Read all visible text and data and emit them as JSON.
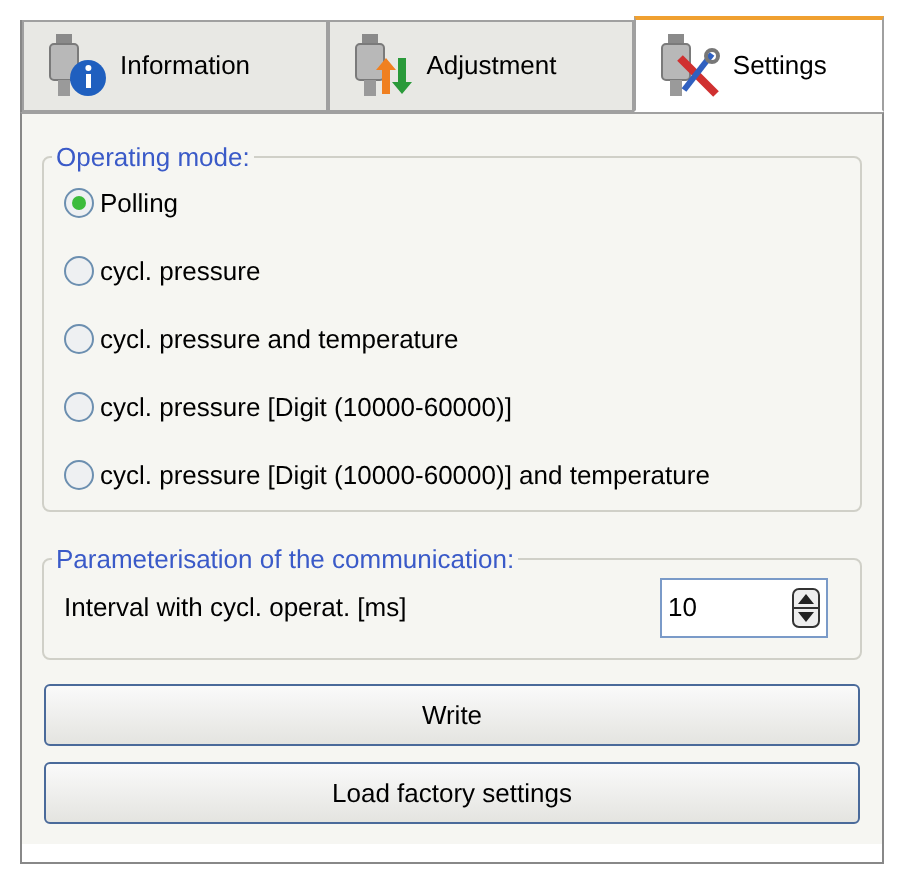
{
  "tabs": [
    {
      "label": "Information",
      "kind": "info",
      "selected": false
    },
    {
      "label": "Adjustment",
      "kind": "adjust",
      "selected": false
    },
    {
      "label": "Settings",
      "kind": "tools",
      "selected": true
    }
  ],
  "operating_mode": {
    "title": "Operating mode:",
    "options": [
      {
        "label": "Polling",
        "selected": true
      },
      {
        "label": "cycl. pressure",
        "selected": false
      },
      {
        "label": "cycl. pressure and temperature",
        "selected": false
      },
      {
        "label": "cycl. pressure [Digit (10000-60000)]",
        "selected": false
      },
      {
        "label": "cycl. pressure [Digit (10000-60000)] and temperature",
        "selected": false
      }
    ]
  },
  "communication": {
    "title": "Parameterisation of the communication:",
    "label": "Interval with cycl. operat. [ms]",
    "value": "10"
  },
  "buttons": [
    "Write",
    "Load factory settings"
  ]
}
